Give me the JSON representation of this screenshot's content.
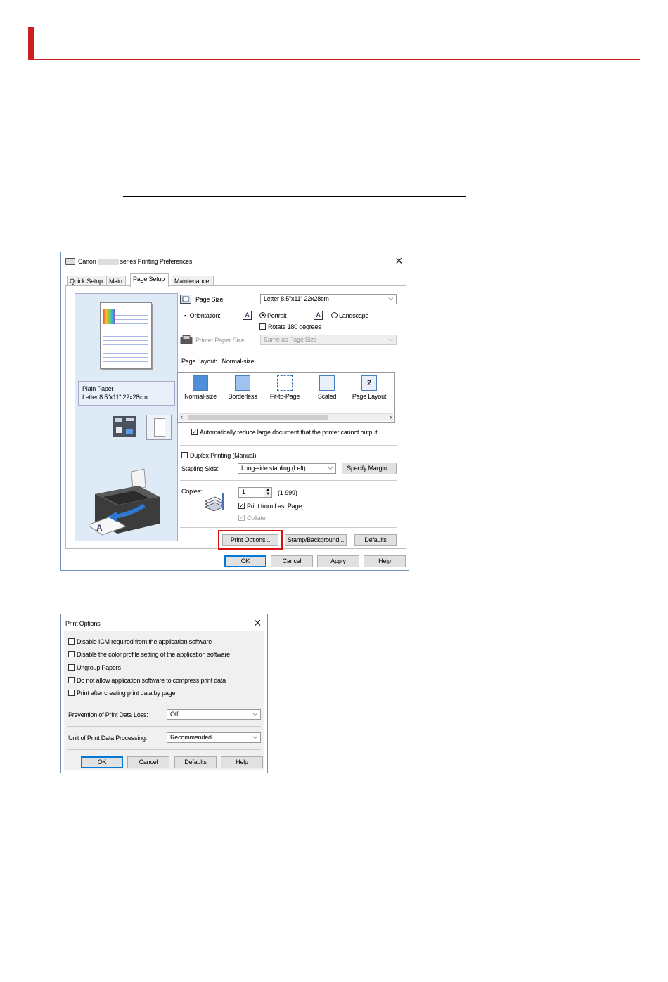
{
  "main_dialog": {
    "title_prefix": "Canon",
    "title_suffix": "series Printing Preferences",
    "tabs": [
      {
        "label": "Quick Setup"
      },
      {
        "label": "Main"
      },
      {
        "label": "Page Setup"
      },
      {
        "label": "Maintenance"
      }
    ],
    "active_tab": "Page Setup",
    "preview": {
      "media_type": "Plain Paper",
      "paper_size": "Letter 8.5\"x11\" 22x28cm"
    },
    "page_size": {
      "label": "Page Size:",
      "value": "Letter 8.5\"x11\" 22x28cm"
    },
    "orientation": {
      "label": "Orientation:",
      "portrait": "Portrait",
      "landscape": "Landscape",
      "selected": "Portrait"
    },
    "rotate_180": {
      "label": "Rotate 180 degrees",
      "checked": false
    },
    "printer_paper_size": {
      "label": "Printer Paper Size:",
      "value": "Same as Page Size"
    },
    "page_layout": {
      "label": "Page Layout:",
      "value": "Normal-size",
      "options": [
        {
          "label": "Normal-size"
        },
        {
          "label": "Borderless"
        },
        {
          "label": "Fit-to-Page"
        },
        {
          "label": "Scaled"
        },
        {
          "label": "Page Layout"
        }
      ],
      "page_layout_icon_text": "2"
    },
    "auto_reduce": {
      "label": "Automatically reduce large document that the printer cannot output",
      "checked": true
    },
    "duplex": {
      "label": "Duplex Printing (Manual)",
      "checked": false
    },
    "stapling_side": {
      "label": "Stapling Side:",
      "value": "Long-side stapling (Left)"
    },
    "specify_margin_label": "Specify Margin...",
    "copies": {
      "label": "Copies:",
      "value": "1",
      "range": "(1-999)"
    },
    "print_from_last_page": {
      "label": "Print from Last Page",
      "checked": true
    },
    "collate": {
      "label": "Collate",
      "checked": true
    },
    "buttons": {
      "print_options": "Print Options...",
      "stamp_background": "Stamp/Background...",
      "defaults": "Defaults",
      "ok": "OK",
      "cancel": "Cancel",
      "apply": "Apply",
      "help": "Help"
    }
  },
  "print_options_dialog": {
    "title": "Print Options",
    "checkboxes": [
      {
        "label": "Disable ICM required from the application software",
        "checked": false
      },
      {
        "label": "Disable the color profile setting of the application software",
        "checked": false
      },
      {
        "label": "Ungroup Papers",
        "checked": false
      },
      {
        "label": "Do not allow application software to compress print data",
        "checked": false
      },
      {
        "label": "Print after creating print data by page",
        "checked": false
      }
    ],
    "prevention": {
      "label": "Prevention of Print Data Loss:",
      "value": "Off"
    },
    "unit_processing": {
      "label": "Unit of Print Data Processing:",
      "value": "Recommended"
    },
    "buttons": {
      "ok": "OK",
      "cancel": "Cancel",
      "defaults": "Defaults",
      "help": "Help"
    }
  },
  "icons": {
    "close": "close-icon",
    "printer": "printer-icon",
    "chevron": "chevron-down-icon"
  },
  "colors": {
    "header_red": "#cc1e1e",
    "highlight_red": "#dd1111",
    "default_button_blue": "#0078d7"
  }
}
